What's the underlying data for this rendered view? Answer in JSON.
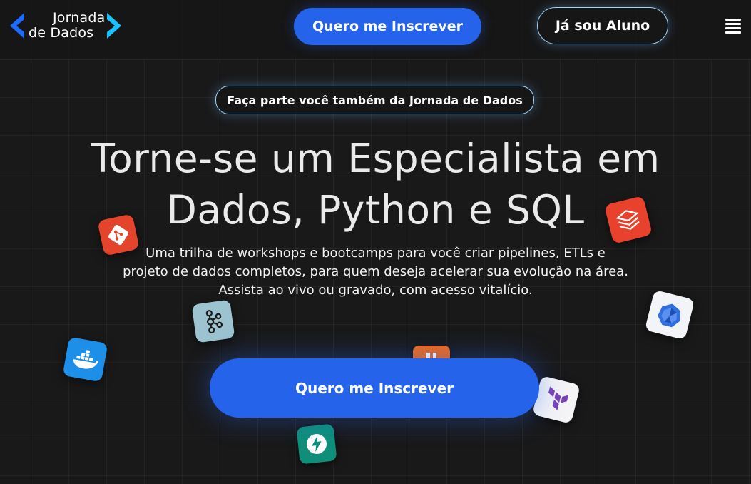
{
  "header": {
    "logo_line1": "Jornada",
    "logo_line2": "de Dados",
    "primary_button": "Quero me Inscrever",
    "secondary_button": "Já sou Aluno",
    "menu_icon": "hamburger-menu-icon"
  },
  "hero": {
    "badge": "Faça parte você também da Jornada de Dados",
    "title_line1": "Torne-se um Especialista em",
    "title_line2": "Dados, Python e SQL",
    "subtitle_line1": "Uma trilha de workshops e bootcamps para você criar pipelines, ETLs e",
    "subtitle_line2": "projeto de dados completos, para quem deseja acelerar sua evolução na área.",
    "subtitle_line3": "Assista ao vivo ou gravado, com acesso vitalício.",
    "cta_button": "Quero me Inscrever"
  },
  "floating_icons": [
    "git-icon",
    "databricks-icon",
    "kafka-icon",
    "kubernetes-icon",
    "docker-icon",
    "orange-tool-icon",
    "terraform-icon",
    "fastapi-icon"
  ],
  "colors": {
    "background": "#19191a",
    "accent_blue": "#2563eb",
    "outline_glow": "#9fd3ff",
    "logo_blue": "#1e6bff",
    "logo_cyan": "#19c2ff"
  }
}
